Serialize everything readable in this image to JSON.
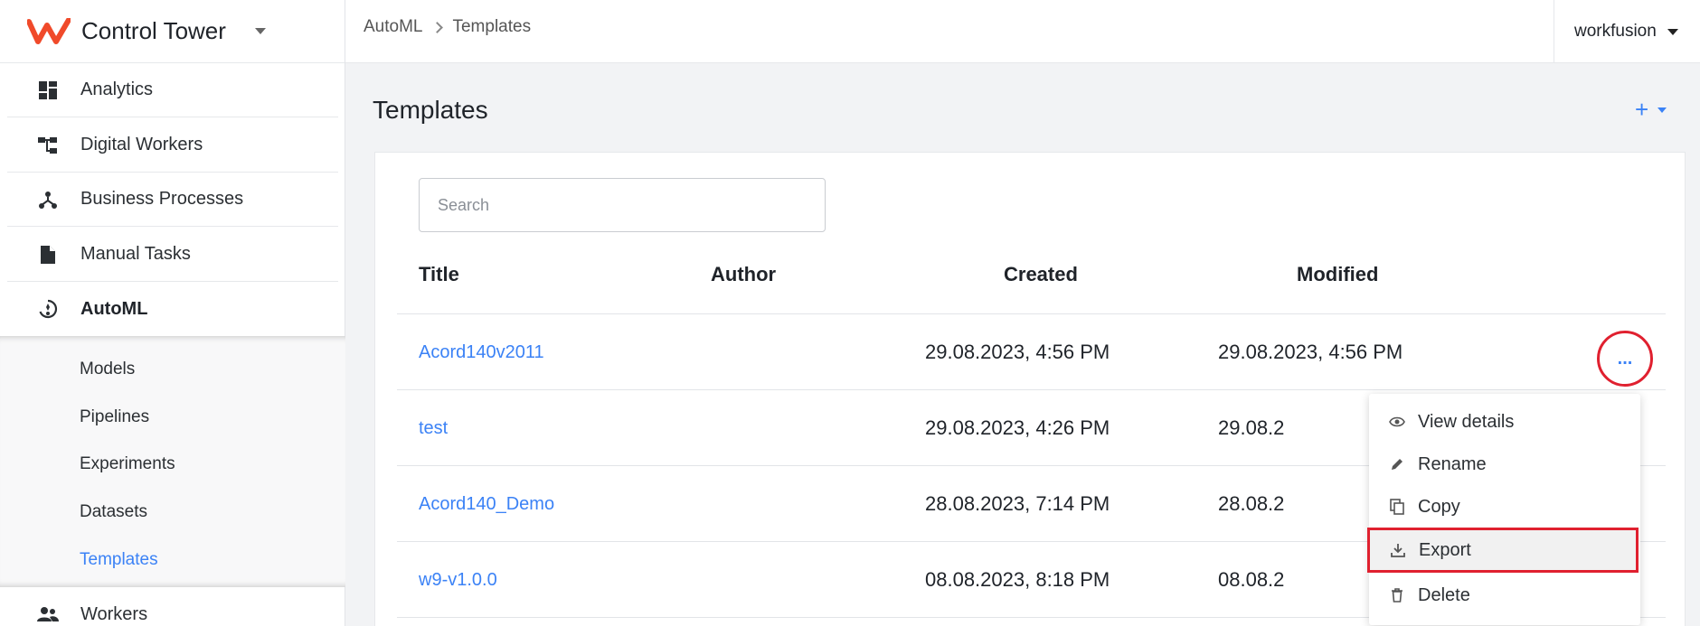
{
  "app": {
    "name": "Control Tower"
  },
  "breadcrumb": [
    "AutoML",
    "Templates"
  ],
  "user": {
    "name": "workfusion"
  },
  "sidebar": {
    "items": [
      {
        "label": "Analytics",
        "icon": "dashboard-icon"
      },
      {
        "label": "Digital Workers",
        "icon": "hierarchy-icon"
      },
      {
        "label": "Business Processes",
        "icon": "process-icon"
      },
      {
        "label": "Manual Tasks",
        "icon": "document-icon"
      },
      {
        "label": "AutoML",
        "icon": "automl-icon"
      },
      {
        "label": "Workers",
        "icon": "people-icon"
      }
    ],
    "submenu": [
      "Models",
      "Pipelines",
      "Experiments",
      "Datasets",
      "Templates"
    ]
  },
  "page": {
    "title": "Templates",
    "add_label": "+"
  },
  "search": {
    "placeholder": "Search"
  },
  "table": {
    "columns": [
      "Title",
      "Author",
      "Created",
      "Modified"
    ],
    "rows": [
      {
        "title": "Acord140v2011",
        "author": "",
        "created": "29.08.2023, 4:56 PM",
        "modified": "29.08.2023, 4:56 PM"
      },
      {
        "title": "test",
        "author": "",
        "created": "29.08.2023, 4:26 PM",
        "modified": "29.08.2"
      },
      {
        "title": "Acord140_Demo",
        "author": "",
        "created": "28.08.2023, 7:14 PM",
        "modified": "28.08.2"
      },
      {
        "title": "w9-v1.0.0",
        "author": "",
        "created": "08.08.2023, 8:18 PM",
        "modified": "08.08.2"
      }
    ]
  },
  "row_menu": {
    "more_label": "...",
    "items": [
      "View details",
      "Rename",
      "Copy",
      "Export",
      "Delete"
    ]
  },
  "colors": {
    "accent": "#3b82f6",
    "highlight": "#e0202f",
    "brand": "#f04a2a"
  }
}
